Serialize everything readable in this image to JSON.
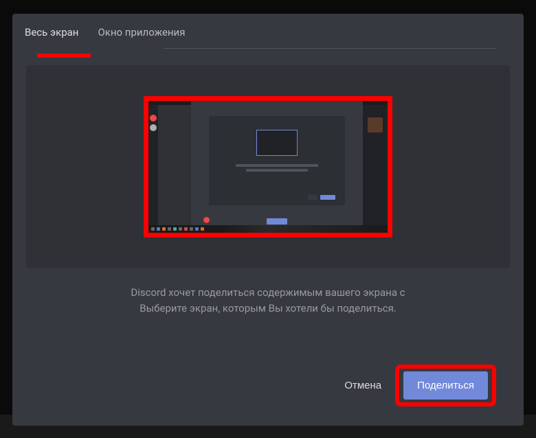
{
  "tabs": {
    "fullscreen": "Весь экран",
    "app_window": "Окно приложения"
  },
  "description": {
    "line1": "Discord хочет поделиться содержимым вашего экрана с",
    "line2": "Выберите экран, которым Вы хотели бы поделиться."
  },
  "footer": {
    "cancel": "Отмена",
    "share": "Поделиться"
  }
}
